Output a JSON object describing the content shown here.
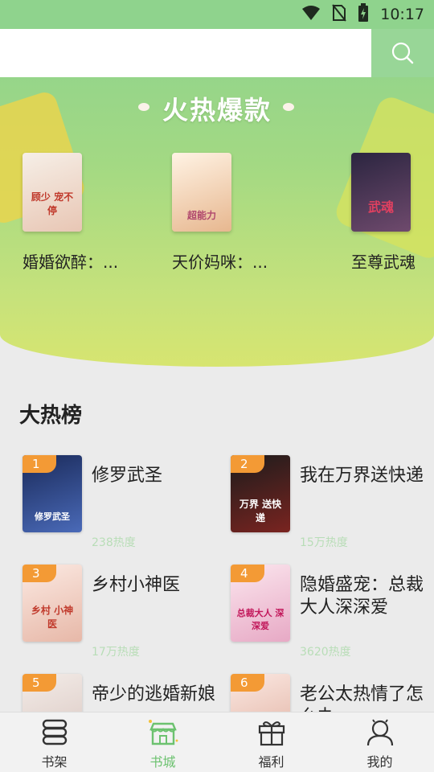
{
  "status_bar": {
    "time": "10:17"
  },
  "search": {
    "placeholder": ""
  },
  "hot_section": {
    "title": "火热爆款",
    "books": [
      {
        "name": "婚婚欲醉：...",
        "cover_text": "顾少 宠不停",
        "colors": [
          "#f6efe7",
          "#e8c6b4"
        ],
        "text_color": "#c0392b"
      },
      {
        "name": "天价妈咪：...",
        "cover_text": "超能力",
        "colors": [
          "#fff3e4",
          "#e7b78f"
        ],
        "text_color": "#b0486d"
      },
      {
        "name": "至尊武魂",
        "cover_text": "武魂",
        "colors": [
          "#2b2540",
          "#6f4a6d"
        ],
        "text_color": "#e04060"
      }
    ]
  },
  "hot_list": {
    "title": "大热榜",
    "items": [
      {
        "rank": "1",
        "title": "修罗武圣",
        "heat": "238热度",
        "cover_text": "修罗武圣",
        "colors": [
          "#1a2a5a",
          "#4a6ab8"
        ]
      },
      {
        "rank": "2",
        "title": "我在万界送快递",
        "heat": "15万热度",
        "cover_text": "万界 送快递",
        "colors": [
          "#1c1c1c",
          "#7a2420"
        ]
      },
      {
        "rank": "3",
        "title": "乡村小神医",
        "heat": "17万热度",
        "cover_text": "乡村 小神医",
        "colors": [
          "#fbe9e2",
          "#e7b8a8"
        ]
      },
      {
        "rank": "4",
        "title": "隐婚盛宠：总裁大人深深爱",
        "heat": "3620热度",
        "cover_text": "总裁大人 深深爱",
        "colors": [
          "#fbe6ee",
          "#e7a9c5"
        ]
      },
      {
        "rank": "5",
        "title": "帝少的逃婚新娘",
        "heat": "",
        "cover_text": "",
        "colors": [
          "#f3ece8",
          "#d9c6c0"
        ]
      },
      {
        "rank": "6",
        "title": "老公太热情了怎么办",
        "heat": "",
        "cover_text": "",
        "colors": [
          "#fbe8e2",
          "#e0b0a0"
        ]
      }
    ]
  },
  "tabs": [
    {
      "label": "书架",
      "icon": "bookshelf-icon"
    },
    {
      "label": "书城",
      "icon": "store-icon",
      "active": true
    },
    {
      "label": "福利",
      "icon": "gift-icon"
    },
    {
      "label": "我的",
      "icon": "profile-icon"
    }
  ],
  "colors": {
    "accent": "#8fd38d",
    "badge": "#f39a35",
    "active_tab": "#6cc26f"
  }
}
